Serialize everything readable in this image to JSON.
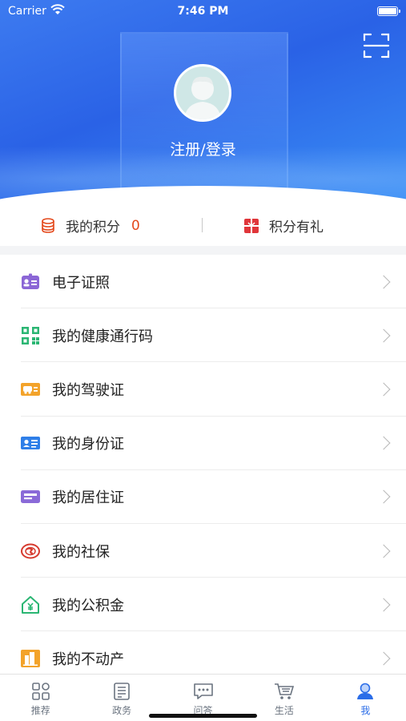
{
  "status_bar": {
    "carrier": "Carrier",
    "time": "7:46 PM"
  },
  "header": {
    "login_label": "注册/登录",
    "scan_icon": "scan-icon"
  },
  "points": {
    "my_points_label": "我的积分",
    "my_points_value": "0",
    "gifts_label": "积分有礼"
  },
  "menu": [
    {
      "label": "电子证照",
      "icon": "e-license-icon",
      "color": "#8b66d6"
    },
    {
      "label": "我的健康通行码",
      "icon": "qr-code-icon",
      "color": "#2bb673"
    },
    {
      "label": "我的驾驶证",
      "icon": "driver-license-icon",
      "color": "#f3a32a"
    },
    {
      "label": "我的身份证",
      "icon": "id-card-icon",
      "color": "#2f7fe8"
    },
    {
      "label": "我的居住证",
      "icon": "residence-permit-icon",
      "color": "#8a6ad8"
    },
    {
      "label": "我的社保",
      "icon": "social-security-icon",
      "color": "#d63b2f"
    },
    {
      "label": "我的公积金",
      "icon": "housing-fund-icon",
      "color": "#2bb673"
    },
    {
      "label": "我的不动产",
      "icon": "real-estate-icon",
      "color": "#f3a32a"
    }
  ],
  "tabs": [
    {
      "label": "推荐",
      "icon": "recommend-icon"
    },
    {
      "label": "政务",
      "icon": "government-icon"
    },
    {
      "label": "问答",
      "icon": "qa-icon"
    },
    {
      "label": "生活",
      "icon": "life-cart-icon"
    },
    {
      "label": "我",
      "icon": "profile-icon",
      "active": true
    }
  ],
  "colors": {
    "accent": "#2b6de8",
    "points_value": "#e4491c"
  }
}
